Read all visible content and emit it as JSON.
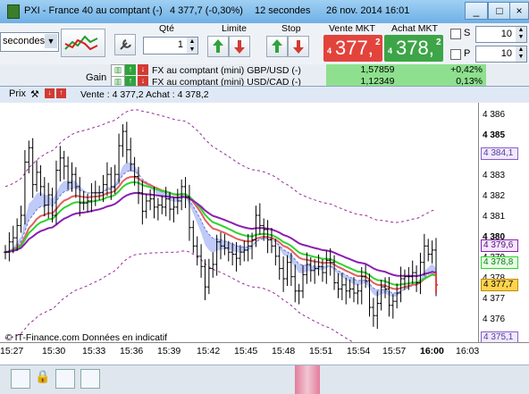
{
  "window": {
    "title_instrument": "PXI - France 40 au comptant (-)",
    "title_price": "4 377,7 (-0,30%)",
    "title_interval": "12 secondes",
    "title_date": "26 nov. 2014 16:01",
    "controls": [
      "_",
      "□",
      "×"
    ]
  },
  "toolbar": {
    "interval_select": "secondes",
    "qty_label": "Qté",
    "qty_value": "1",
    "limit_label": "Limite",
    "stop_label": "Stop",
    "sell_label": "Vente MKT",
    "sell_prefix": "4",
    "sell_main": "377,",
    "sell_sup": "2",
    "buy_label": "Achat MKT",
    "buy_prefix": "4",
    "buy_main": "378,",
    "buy_sup": "2",
    "s_label": "S",
    "s_value": "10",
    "p_label": "P",
    "p_value": "10"
  },
  "watchlist": {
    "gain_label": "Gain",
    "rows": [
      {
        "name": "FX au comptant (mini) GBP/USD (-)",
        "price": "1,57859",
        "change": "+0,42%"
      },
      {
        "name": "FX au comptant (mini) USD/CAD (-)",
        "price": "1,12349",
        "change": "0,13%"
      }
    ]
  },
  "chart_header": {
    "prix_label": "Prix",
    "quote_text": "Vente : 4 377,2 Achat : 4 378,2"
  },
  "axis": {
    "y_ticks": [
      "4 386",
      "4 385",
      "4 384",
      "4 383",
      "4 382",
      "4 381",
      "4 380",
      "4 379",
      "4 378",
      "4 377",
      "4 376",
      "4 375"
    ],
    "y_tags": [
      {
        "text": "4 384,1",
        "kind": "upper"
      },
      {
        "text": "4 379,6",
        "kind": "purple"
      },
      {
        "text": "4 378,8",
        "kind": "green"
      },
      {
        "text": "4 377,7",
        "kind": "last"
      },
      {
        "text": "4 375,1",
        "kind": "lower"
      }
    ],
    "x_ticks": [
      "15:27",
      "15:30",
      "15:33",
      "15:36",
      "15:39",
      "15:42",
      "15:45",
      "15:48",
      "15:51",
      "15:54",
      "15:57",
      "16:00",
      "16:03"
    ]
  },
  "footer_note": "© IT-Finance.com Données en indicatif",
  "colors": {
    "sell": "#e8403a",
    "buy": "#3fae49",
    "ma_purple": "#8a1fb0",
    "ma_green": "#2fd32f",
    "ma_red": "#e06060",
    "band_dashed": "#9a2a9a",
    "cloud": "#a9b8f5"
  },
  "chart_data": {
    "type": "line",
    "x_range": [
      "15:27",
      "16:03"
    ],
    "ylim": [
      4374.9,
      4386.6
    ],
    "last_price": 4377.7,
    "series": [
      {
        "values_close": [
          4379.3,
          4379.8,
          4380.0,
          4380.6,
          4381.1,
          4383.7,
          4384.4,
          4382.6,
          4383.2,
          4382.5,
          4381.6,
          4382.1,
          4381.1,
          4383.3,
          4383.9,
          4383.5,
          4382.7,
          4383.1,
          4382.5,
          4381.7,
          4381.7,
          4381.8,
          4382.2,
          4382.2,
          4382.2,
          4382.6,
          4383.1,
          4382.5,
          4383.1,
          4384.5,
          4385.2,
          4384.3,
          4383.6,
          4383.0,
          4382.2,
          4381.3,
          4381.8,
          4381.9,
          4381.5,
          4381.6,
          4381.5,
          4381.9,
          4381.4,
          4381.5,
          4381.8,
          4382.5,
          4382.0,
          4380.5,
          4379.6,
          4379.1,
          4378.6,
          4377.6,
          4378.5,
          4378.7,
          4379.8,
          4379.6,
          4379.5,
          4379.3,
          4379.2,
          4379.0,
          4379.3,
          4379.4,
          4379.6,
          4379.9,
          4381.1,
          4380.6,
          4380.4,
          4379.9,
          4379.6,
          4379.1,
          4378.5,
          4378.0,
          4378.8,
          4378.1,
          4377.4,
          4377.4,
          4378.2,
          4378.7,
          4378.4,
          4378.5,
          4378.6,
          4378.3,
          4378.9,
          4378.8,
          4377.8,
          4377.5,
          4377.7,
          4377.4,
          4377.5,
          4377.3,
          4377.4,
          4378.1,
          4377.9,
          4376.6,
          4376.2,
          4376.8,
          4377.6,
          4377.5,
          4376.7,
          4376.9,
          4377.3,
          4378.0,
          4378.1,
          4378.1,
          4378.3,
          4377.8,
          4378.8,
          4379.6,
          4379.2,
          4379.4,
          4377.7
        ]
      }
    ]
  }
}
